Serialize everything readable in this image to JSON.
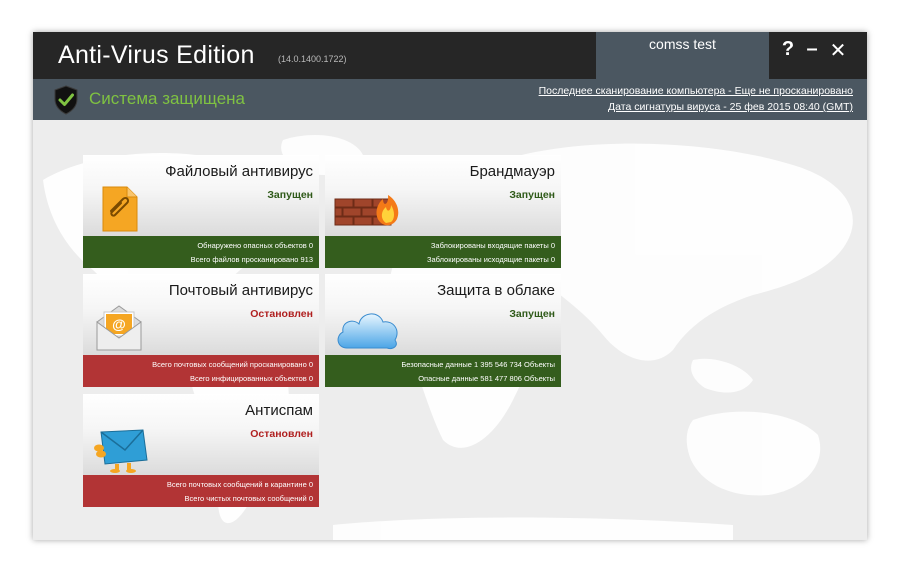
{
  "window": {
    "title": "Anti-Virus Edition",
    "version": "(14.0.1400.1722)",
    "user": "comss test",
    "controls": {
      "help": "?",
      "minimize": "–",
      "close": "✕"
    }
  },
  "status": {
    "text": "Система защищена",
    "last_scan": "Последнее сканирование компьютера - Еще не просканировано",
    "signature_date": "Дата сигнатуры вируса - 25 фев 2015 08:40 (GMT)"
  },
  "tiles": [
    {
      "title": "Файловый антивирус",
      "state": "Запущен",
      "icon": "file-antivirus-icon",
      "stats": [
        "Обнаружено опасных объектов  0",
        "Всего файлов просканировано  913"
      ]
    },
    {
      "title": "Брандмауэр",
      "state": "Запущен",
      "icon": "firewall-icon",
      "stats": [
        "Заблокированы входящие пакеты  0",
        "Заблокированы исходящие пакеты  0"
      ]
    },
    {
      "title": "Почтовый антивирус",
      "state": "Остановлен",
      "icon": "mail-antivirus-icon",
      "stats": [
        "Всего почтовых сообщений просканировано  0",
        "Всего инфицированных объектов  0"
      ]
    },
    {
      "title": "Защита в облаке",
      "state": "Запущен",
      "icon": "cloud-icon",
      "stats": [
        "Безопасные данные  1 395 546 734 Объекты",
        "Опасные данные  581 477 806 Объекты"
      ]
    },
    {
      "title": "Антиспам",
      "state": "Остановлен",
      "icon": "antispam-icon",
      "stats": [
        "Всего почтовых сообщений в карантине  0",
        "Всего чистых почтовых сообщений  0"
      ]
    }
  ],
  "colors": {
    "titlebar": "#262626",
    "statusbar": "#4b5761",
    "status_ok": "#7fc242",
    "running_footer": "#345d1d",
    "stopped_footer": "#b23435",
    "running_text": "#2f5a19",
    "stopped_text": "#b02020"
  }
}
